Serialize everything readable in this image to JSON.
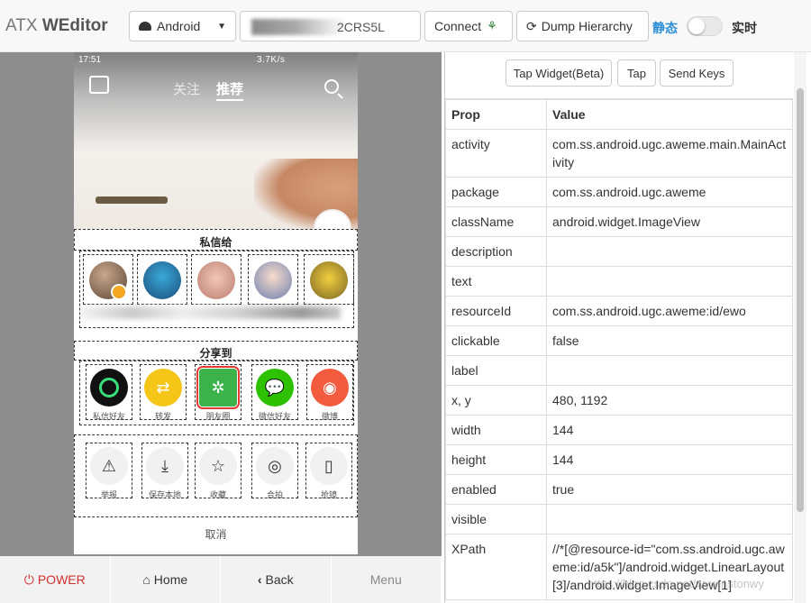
{
  "app": {
    "brand_light": "ATX ",
    "brand_bold": "WEditor"
  },
  "toolbar": {
    "platform": "Android",
    "device_serial": "2CRS5L",
    "connect": "Connect",
    "dump": "Dump Hierarchy",
    "mode_static": "静态",
    "mode_live": "实时",
    "live_enabled": false
  },
  "phone": {
    "time": "17:51",
    "status_info": "3.7K/s",
    "tabs": [
      "关注",
      "推荐"
    ],
    "share_to_title": "私信给",
    "share_section_title": "分享到",
    "share_items": [
      {
        "label": "私信好友",
        "icon": "chat-ring-icon",
        "color": "#111111"
      },
      {
        "label": "转发",
        "icon": "repost-icon",
        "color": "#f5c518"
      },
      {
        "label": "朋友圈",
        "icon": "moments-icon",
        "color": "#3bb34a"
      },
      {
        "label": "微信好友",
        "icon": "wechat-icon",
        "color": "#2dc100"
      },
      {
        "label": "微博",
        "icon": "weibo-icon",
        "color": "#f35b3f"
      }
    ],
    "action_items": [
      {
        "label": "举报",
        "icon": "warning-icon",
        "glyph": "⚠"
      },
      {
        "label": "保存本地",
        "icon": "download-icon",
        "glyph": "⤓"
      },
      {
        "label": "收藏",
        "icon": "star-icon",
        "glyph": "☆"
      },
      {
        "label": "合拍",
        "icon": "duet-icon",
        "glyph": "◎"
      },
      {
        "label": "抢镜",
        "icon": "phone-frame-icon",
        "glyph": "▯"
      }
    ],
    "cancel": "取消"
  },
  "nav": {
    "power": "POWER",
    "home": "Home",
    "back": "Back",
    "menu": "Menu"
  },
  "actions": {
    "tap_widget": "Tap Widget(Beta)",
    "tap": "Tap",
    "send_keys": "Send Keys"
  },
  "props": {
    "header": {
      "prop": "Prop",
      "value": "Value"
    },
    "rows": [
      {
        "k": "activity",
        "v": "com.ss.android.ugc.aweme.main.MainActivity"
      },
      {
        "k": "package",
        "v": "com.ss.android.ugc.aweme"
      },
      {
        "k": "className",
        "v": "android.widget.ImageView"
      },
      {
        "k": "description",
        "v": ""
      },
      {
        "k": "text",
        "v": ""
      },
      {
        "k": "resourceId",
        "v": "com.ss.android.ugc.aweme:id/ewo"
      },
      {
        "k": "clickable",
        "v": "false"
      },
      {
        "k": "label",
        "v": ""
      },
      {
        "k": "x, y",
        "v": "480, 1192"
      },
      {
        "k": "width",
        "v": "144"
      },
      {
        "k": "height",
        "v": "144"
      },
      {
        "k": "enabled",
        "v": "true"
      },
      {
        "k": "visible",
        "v": ""
      },
      {
        "k": "XPath",
        "v": "//*[@resource-id=\"com.ss.android.ugc.aweme:id/a5k\"]/android.widget.LinearLayout[3]/android.widget.ImageView[1]"
      }
    ]
  },
  "watermark": "https://blog.csdn.net/wywinstonwy"
}
